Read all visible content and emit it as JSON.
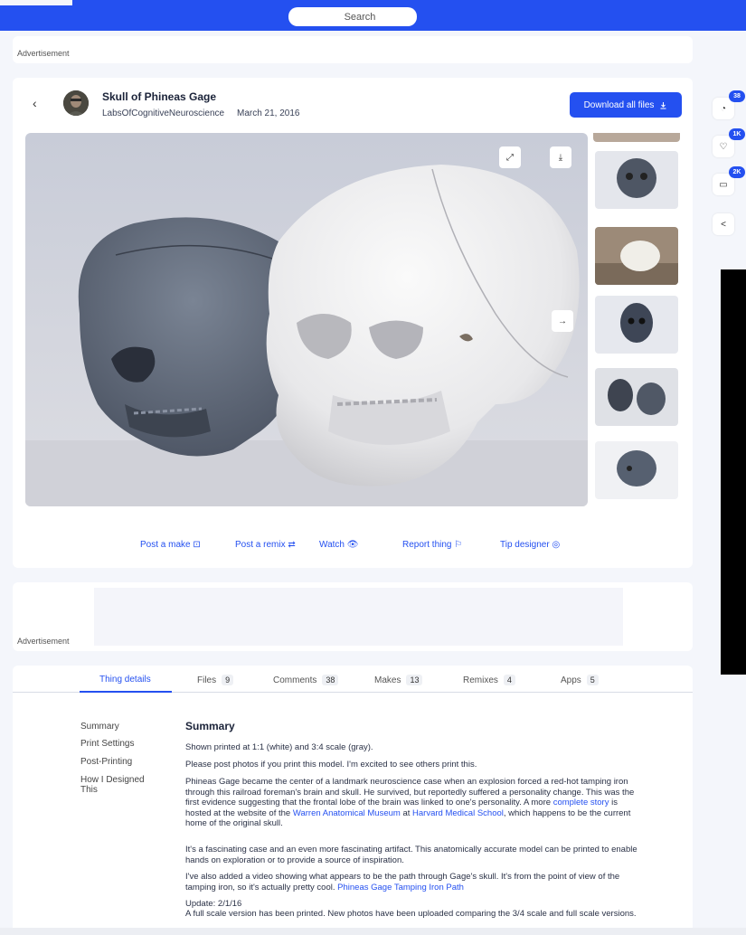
{
  "search": {
    "placeholder": "Search"
  },
  "ads": {
    "label1": "Advertisement",
    "label2": "Advertisement"
  },
  "thing": {
    "title": "Skull of Phineas Gage",
    "author": "LabsOfCognitiveNeuroscience",
    "date": "March 21, 2016",
    "download_label": "Download all files"
  },
  "actions": [
    "Post a make",
    "Post a remix",
    "Watch",
    "Report thing",
    "Tip designer"
  ],
  "side": {
    "comments_count": "38",
    "likes_count": "1K",
    "collections_count": "2K"
  },
  "tabs": [
    {
      "label": "Thing details",
      "count": ""
    },
    {
      "label": "Files",
      "count": "9"
    },
    {
      "label": "Comments",
      "count": "38"
    },
    {
      "label": "Makes",
      "count": "13"
    },
    {
      "label": "Remixes",
      "count": "4"
    },
    {
      "label": "Apps",
      "count": "5"
    }
  ],
  "toc": [
    "Summary",
    "Print Settings",
    "Post-Printing",
    "How I Designed This"
  ],
  "summary": {
    "heading": "Summary",
    "p1": "Shown printed at 1:1 (white) and 3:4 scale (gray).",
    "p2": "Please post photos if you print this model. I'm excited to see others print this.",
    "p3a": "Phineas Gage became the center of a landmark neuroscience case when an explosion forced a red-hot tamping iron through this railroad foreman's brain and skull. He survived, but reportedly suffered a personality change. This was the first evidence suggesting that the frontal lobe of the brain was linked to one's personality. A more ",
    "p3_link1": "complete story",
    "p3b": " is hosted at the website of the ",
    "p3_link2": "Warren Anatomical Museum",
    "p3c": " at ",
    "p3_link3": "Harvard Medical School",
    "p3d": ", which happens to be the current home of the original skull.",
    "p4": "It's a fascinating case and an even more fascinating artifact. This anatomically accurate model can be printed to enable hands on exploration or to provide a source of inspiration.",
    "p5a": "I've also added a video showing what appears to be the path through Gage's skull. It's from the point of view of the tamping iron, so it's actually pretty cool. ",
    "p5_link": "Phineas Gage Tamping Iron Path",
    "p6_title": "Update: 2/1/16",
    "p6": "A full scale version has been printed. New photos have been uploaded comparing the 3/4 scale and full scale versions."
  }
}
